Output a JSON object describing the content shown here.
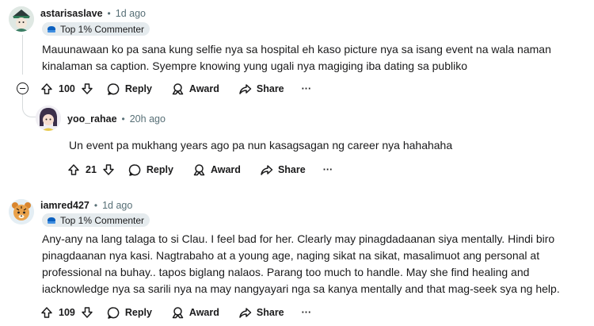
{
  "comments": [
    {
      "username": "astarisaslave",
      "time": "1d ago",
      "badge": "Top 1% Commenter",
      "body": "Mauunawaan ko pa sana kung selfie nya sa hospital eh kaso picture nya sa isang event na wala naman kinalaman sa caption. Syempre knowing yung ugali nya magiging iba dating sa publiko",
      "votes": "100",
      "reply": "Reply",
      "award": "Award",
      "share": "Share",
      "more": "···"
    },
    {
      "username": "yoo_rahae",
      "time": "20h ago",
      "body": "Un event pa mukhang years ago pa nun kasagsagan ng career nya hahahaha",
      "votes": "21",
      "reply": "Reply",
      "award": "Award",
      "share": "Share",
      "more": "···"
    },
    {
      "username": "iamred427",
      "time": "1d ago",
      "badge": "Top 1% Commenter",
      "body": "Any-any na lang talaga to si Clau. I feel bad for her. Clearly may pinagdadaanan siya mentally. Hindi biro pinagdaanan nya kasi. Nagtrabaho at a young age, naging sikat na sikat, masalimuot ang personal at professional na buhay.. tapos biglang nalaos. Parang too much to handle. May she find healing and iacknowledge nya sa sarili nya na may nangyayari nga sa kanya mentally and that mag-seek sya ng help.",
      "votes": "109",
      "reply": "Reply",
      "award": "Award",
      "share": "Share",
      "more": "···"
    }
  ],
  "separator": "•",
  "colors": {
    "text": "#1a1a1b",
    "meta": "#576f76",
    "badge_bg": "#e5ebee",
    "badge_icon": "#0a5fbf"
  }
}
